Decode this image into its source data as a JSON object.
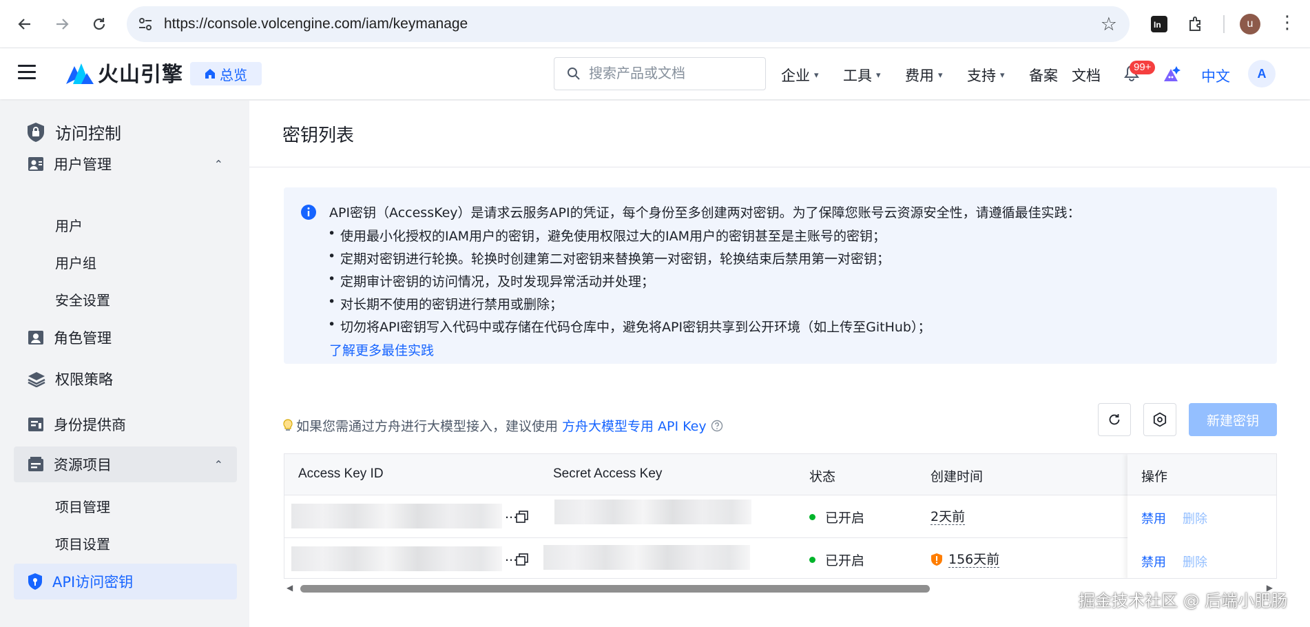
{
  "browser": {
    "url": "https://console.volcengine.com/iam/keymanage",
    "profile_initial": "u",
    "icons": [
      "back-arrow-icon",
      "forward-arrow-icon",
      "reload-icon",
      "site-settings-icon",
      "bookmark-star-icon",
      "extension-icon",
      "puzzle-icon",
      "kebab-menu-icon"
    ]
  },
  "header": {
    "logo_text": "火山引擎",
    "overview_label": "总览",
    "search_placeholder": "搜索产品或文档",
    "nav": [
      {
        "label": "企业",
        "has_dropdown": true
      },
      {
        "label": "工具",
        "has_dropdown": true
      },
      {
        "label": "费用",
        "has_dropdown": true
      },
      {
        "label": "支持",
        "has_dropdown": true
      },
      {
        "label": "备案",
        "has_dropdown": false
      },
      {
        "label": "文档",
        "has_dropdown": false
      }
    ],
    "notification_badge": "99+",
    "language": "中文",
    "avatar_initial": "A"
  },
  "sidebar": {
    "title": "访问控制",
    "items": [
      {
        "label": "用户管理",
        "icon": "user-manage-icon",
        "expanded": true
      },
      {
        "label": "用户"
      },
      {
        "label": "用户组"
      },
      {
        "label": "安全设置"
      },
      {
        "label": "角色管理",
        "icon": "role-icon"
      },
      {
        "label": "权限策略",
        "icon": "layers-icon"
      },
      {
        "label": "身份提供商",
        "icon": "identity-icon"
      },
      {
        "label": "资源项目",
        "icon": "resource-icon",
        "expanded": true
      },
      {
        "label": "项目管理"
      },
      {
        "label": "项目设置"
      },
      {
        "label": "API访问密钥",
        "icon": "shield-key-icon",
        "active": true
      }
    ]
  },
  "main": {
    "page_title": "密钥列表",
    "info": {
      "lead": "API密钥（AccessKey）是请求云服务API的凭证，每个身份至多创建两对密钥。为了保障您账号云资源安全性，请遵循最佳实践：",
      "bullets": [
        "使用最小化授权的IAM用户的密钥，避免使用权限过大的IAM用户的密钥甚至是主账号的密钥；",
        "定期对密钥进行轮换。轮换时创建第二对密钥来替换第一对密钥，轮换结束后禁用第一对密钥；",
        "定期审计密钥的访问情况，及时发现异常活动并处理；",
        "对长期不使用的密钥进行禁用或删除；",
        "切勿将API密钥写入代码中或存储在代码仓库中，避免将API密钥共享到公开环境（如上传至GitHub）；"
      ],
      "link": "了解更多最佳实践"
    },
    "hint_text": "如果您需通过方舟进行大模型接入，建议使用",
    "hint_link": "方舟大模型专用 API Key",
    "create_button": "新建密钥",
    "table": {
      "columns": [
        "Access Key ID",
        "Secret Access Key",
        "状态",
        "创建时间",
        "操作"
      ],
      "rows": [
        {
          "access_key_suffix": "...",
          "status": "已开启",
          "created": "2天前",
          "warning": false,
          "actions": [
            "禁用",
            "删除"
          ]
        },
        {
          "access_key_suffix": "...",
          "status": "已开启",
          "created": "156天前",
          "warning": true,
          "actions": [
            "禁用",
            "删除"
          ]
        }
      ]
    },
    "colors": {
      "accent": "#1664ff",
      "accent_disabled": "#94bfff",
      "status_on": "#00b42a",
      "warning": "#ff7d00"
    }
  },
  "watermark": "掘金技术社区 @ 后端小肥肠"
}
